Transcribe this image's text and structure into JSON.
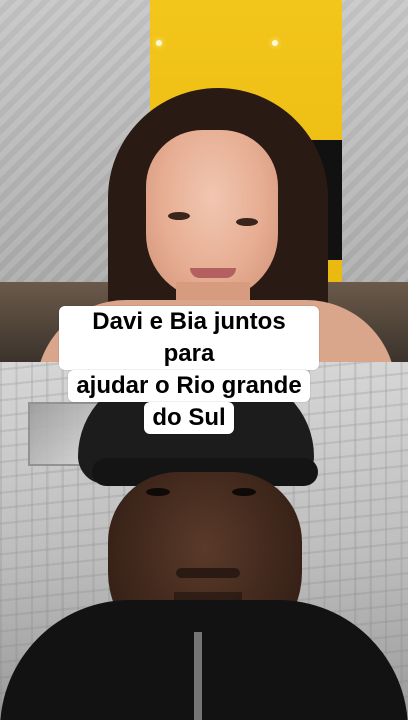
{
  "caption": {
    "line1": "Davi e Bia juntos para",
    "line2": "ajudar o Rio grande",
    "line3": "do Sul"
  }
}
